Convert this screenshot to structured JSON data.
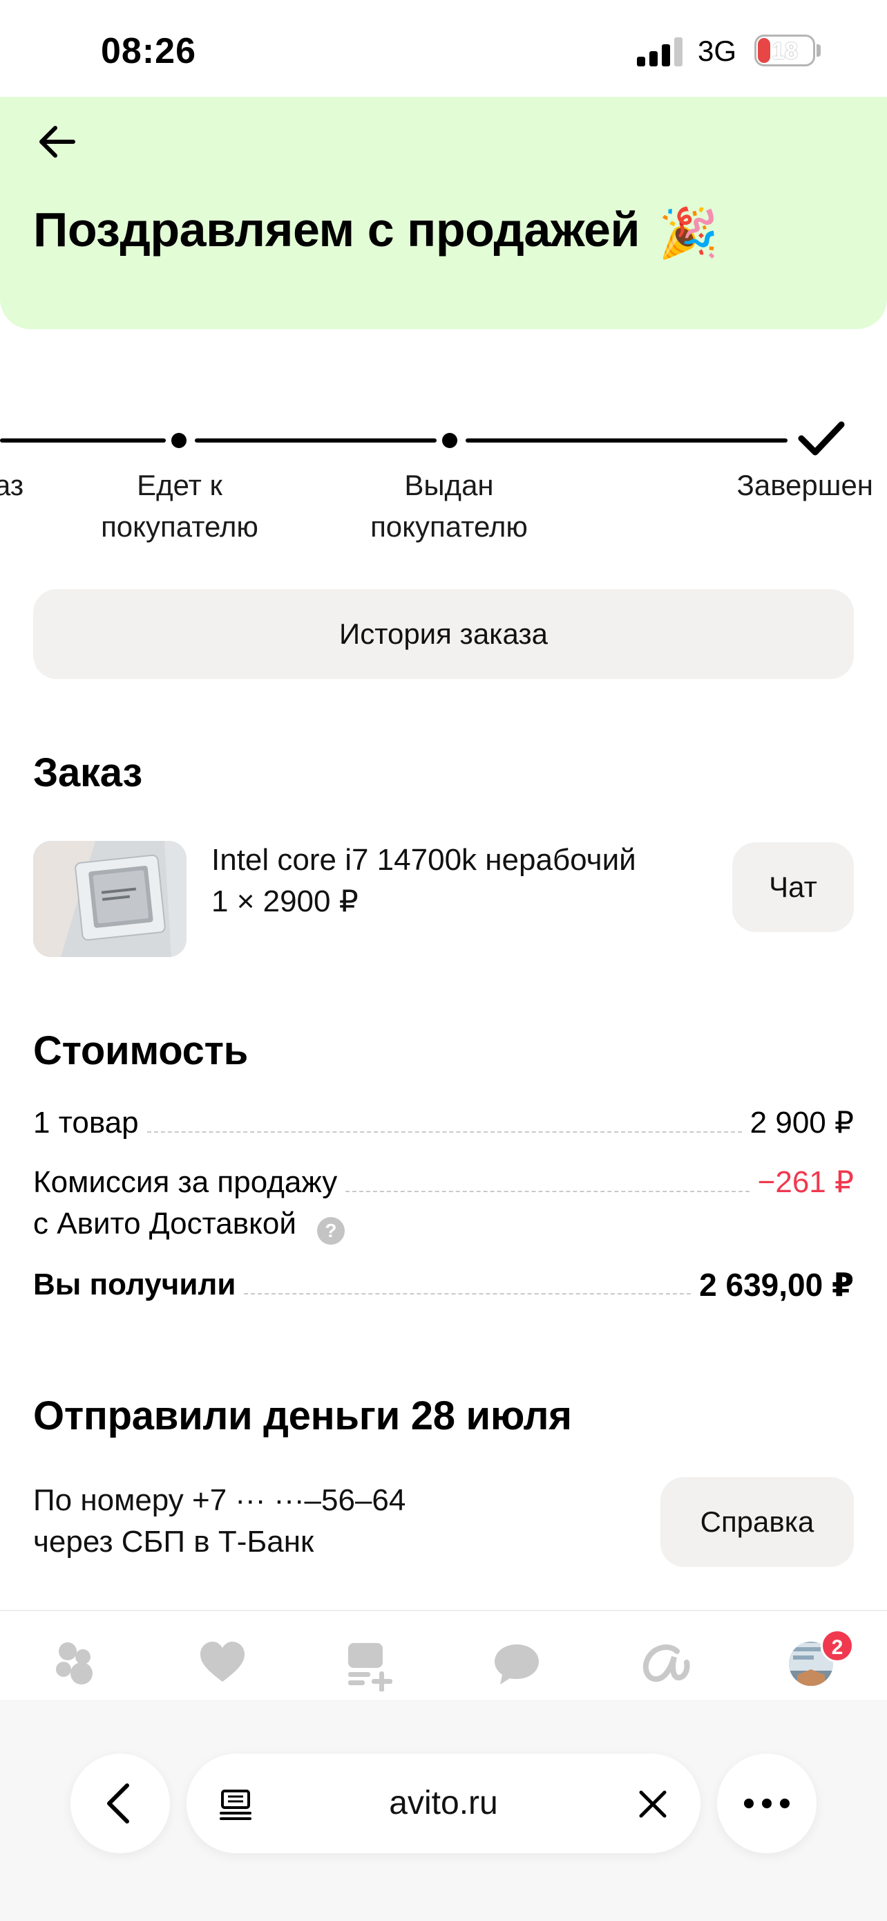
{
  "status_bar": {
    "time": "08:26",
    "network": "3G",
    "battery": "18"
  },
  "header": {
    "title": "Поздравляем с продажей",
    "emoji": "🎉"
  },
  "stepper": {
    "steps": [
      {
        "label": "аз"
      },
      {
        "label": "Едет к\nпокупателю"
      },
      {
        "label": "Выдан\nпокупателю"
      },
      {
        "label": "Завершен"
      }
    ]
  },
  "history_button": "История заказа",
  "order": {
    "title": "Заказ",
    "item_name": "Intel core i7 14700k нерабочий",
    "item_qty": "1 × 2900 ₽",
    "chat_button": "Чат"
  },
  "cost": {
    "title": "Стоимость",
    "rows": [
      {
        "label": "1 товар",
        "value": "2 900 ₽"
      },
      {
        "label": "Комиссия за продажу",
        "label2": "с Авито Доставкой",
        "value": "−261 ₽",
        "value_color": "#f0394f"
      },
      {
        "label": "Вы получили",
        "value": "2 639,00 ₽"
      }
    ],
    "help_icon": "?"
  },
  "transfer": {
    "title": "Отправили деньги 28 июля",
    "text": "По номеру +7 ··· ···–56–64\nчерез СБП в Т-Банк",
    "help_button": "Справка"
  },
  "tabbar": {
    "items": [
      "home-icon",
      "heart-icon",
      "add-listing-icon",
      "chat-icon",
      "avito-icon",
      "profile-avatar"
    ],
    "badge": "2"
  },
  "browser": {
    "url": "avito.ru"
  },
  "colors": {
    "hero_bg": "#e2fcd6",
    "accent_red": "#f0394f",
    "button_bg": "#f2f1f0"
  }
}
